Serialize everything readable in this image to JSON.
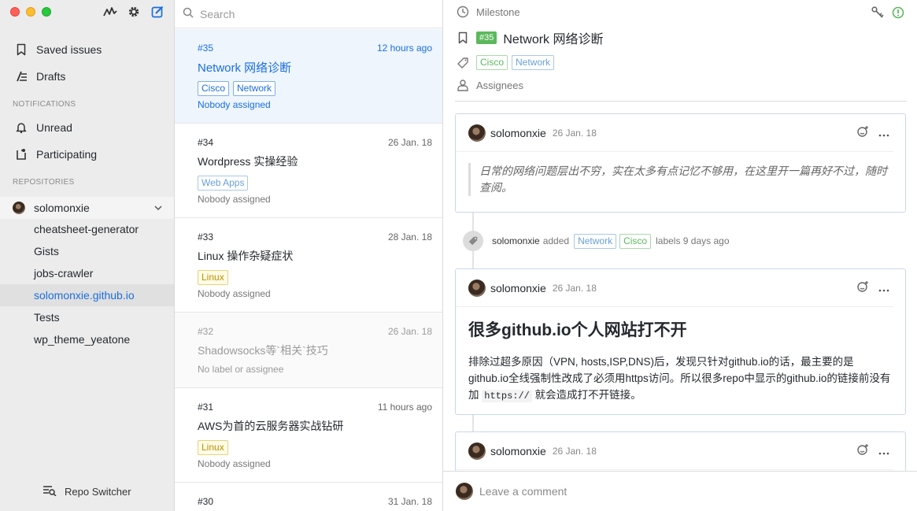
{
  "sidebar": {
    "nav": [
      {
        "label": "Saved issues",
        "icon": "bookmark-icon"
      },
      {
        "label": "Drafts",
        "icon": "drafts-icon"
      }
    ],
    "notifications_header": "NOTIFICATIONS",
    "notifications": [
      {
        "label": "Unread",
        "icon": "bell-icon"
      },
      {
        "label": "Participating",
        "icon": "participating-icon"
      }
    ],
    "repositories_header": "REPOSITORIES",
    "owner": "solomonxie",
    "repos": [
      "cheatsheet-generator",
      "Gists",
      "jobs-crawler",
      "solomonxie.github.io",
      "Tests",
      "wp_theme_yeatone"
    ],
    "selected_repo": "solomonxie.github.io",
    "repo_switcher": "Repo Switcher"
  },
  "search": {
    "placeholder": "Search"
  },
  "issues": [
    {
      "num": "#35",
      "date": "12 hours ago",
      "title": "Network 网络诊断",
      "labels": [
        "Cisco",
        "Network"
      ],
      "assign": "Nobody assigned"
    },
    {
      "num": "#34",
      "date": "26 Jan. 18",
      "title": "Wordpress 实操经验",
      "labels": [
        "Web Apps"
      ],
      "assign": "Nobody assigned"
    },
    {
      "num": "#33",
      "date": "28 Jan. 18",
      "title": "Linux 操作杂疑症状",
      "labels": [
        "Linux"
      ],
      "assign": "Nobody assigned"
    },
    {
      "num": "#32",
      "date": "26 Jan. 18",
      "title": "Shadowsocks等`相关`技巧",
      "labels": [],
      "assign": "No label or assignee"
    },
    {
      "num": "#31",
      "date": "11 hours ago",
      "title": "AWS为首的云服务器实战钻研",
      "labels": [
        "Linux"
      ],
      "assign": "Nobody assigned"
    },
    {
      "num": "#30",
      "date": "31 Jan. 18",
      "title": "",
      "labels": [],
      "assign": ""
    }
  ],
  "colors": {
    "cisco": "#5cb85c",
    "network": "#1a6ee1",
    "webapps": "#6aa0d8",
    "linux": "#c9a400",
    "accent": "#1a6ee1"
  },
  "detail": {
    "milestone": "Milestone",
    "number": "#35",
    "title": "Network 网络诊断",
    "labels": [
      "Cisco",
      "Network"
    ],
    "assignees": "Assignees",
    "comments": [
      {
        "author": "solomonxie",
        "date": "26 Jan. 18",
        "quote": "日常的网络问题层出不穷，实在太多有点记忆不够用，在这里开一篇再好不过，随时查阅。"
      },
      {
        "author": "solomonxie",
        "date": "26 Jan. 18",
        "heading": "很多github.io个人网站打不开",
        "body_pre": "排除过超多原因（VPN, hosts,ISP,DNS)后，发现只针对github.io的话，最主要的是github.io全线强制性改成了必须用https访问。所以很多repo中显示的github.io的链接前没有加 ",
        "body_code": "https://",
        "body_post": " 就会造成打不开链接。"
      },
      {
        "author": "solomonxie",
        "date": "26 Jan. 18"
      }
    ],
    "event": {
      "who": "solomonxie",
      "added": "added",
      "labels": [
        "Network",
        "Cisco"
      ],
      "suffix": "labels 9 days ago"
    },
    "comment_placeholder": "Leave a comment"
  }
}
